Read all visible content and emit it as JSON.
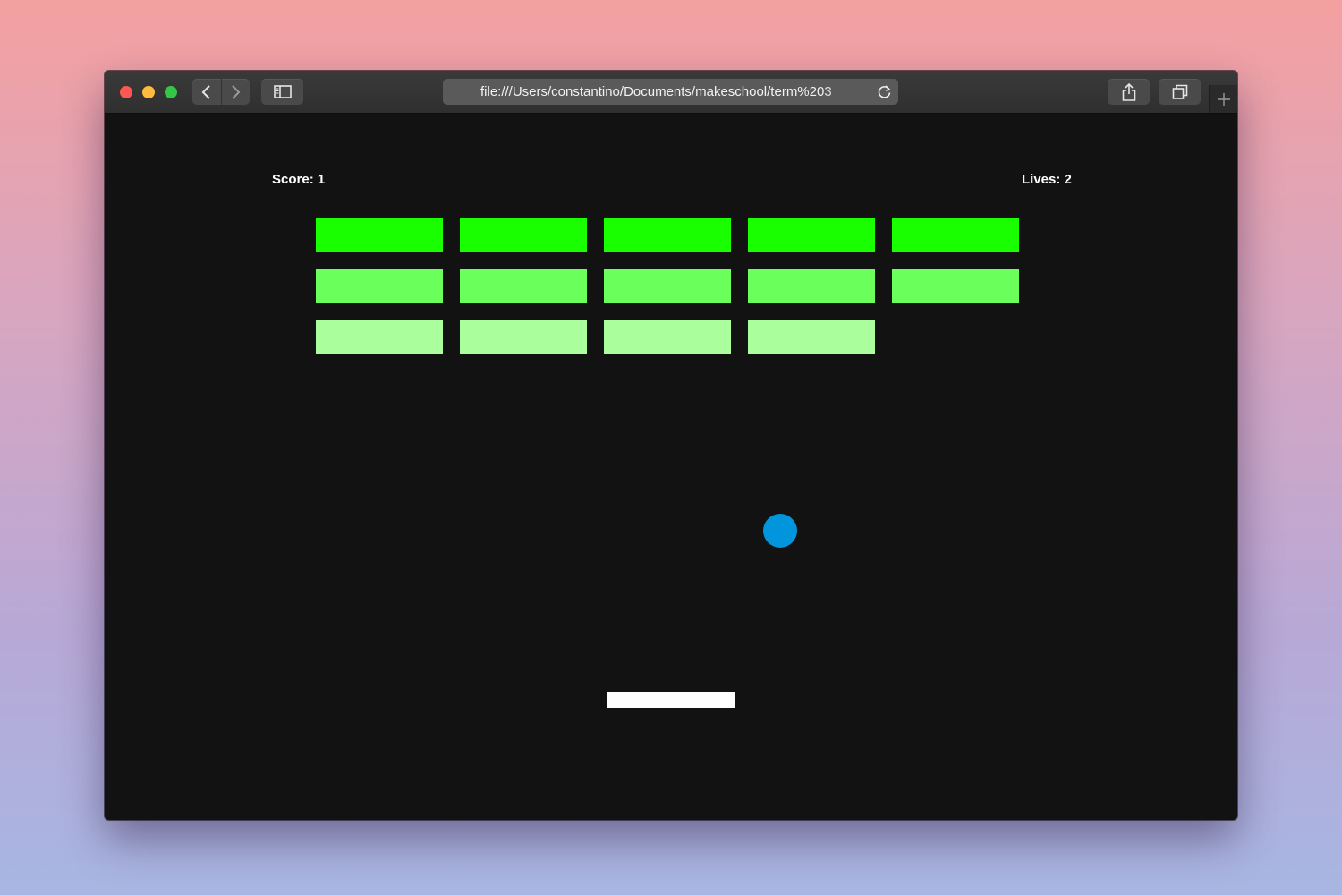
{
  "browser": {
    "address_url": "file:///Users/constantino/Documents/makeschool/term%203",
    "icons": {
      "back": "chevron-left-icon",
      "forward": "chevron-right-icon",
      "sidebar": "sidebar-icon",
      "reload": "reload-icon",
      "share": "share-icon",
      "tabs": "tabs-overview-icon",
      "new_tab": "plus-icon"
    }
  },
  "game": {
    "score_label": "Score: 1",
    "lives_label": "Lives: 2",
    "score": 1,
    "lives": 2,
    "bricks_per_row": 5,
    "brick_rows": [
      {
        "color": "#1aff00",
        "present": [
          true,
          true,
          true,
          true,
          true
        ]
      },
      {
        "color": "#6bff5c",
        "present": [
          true,
          true,
          true,
          true,
          true
        ]
      },
      {
        "color": "#aaff9c",
        "present": [
          true,
          true,
          true,
          true,
          false
        ]
      }
    ],
    "ball_color": "#0095dd",
    "paddle_color": "#ffffff",
    "background_color": "#121212"
  }
}
